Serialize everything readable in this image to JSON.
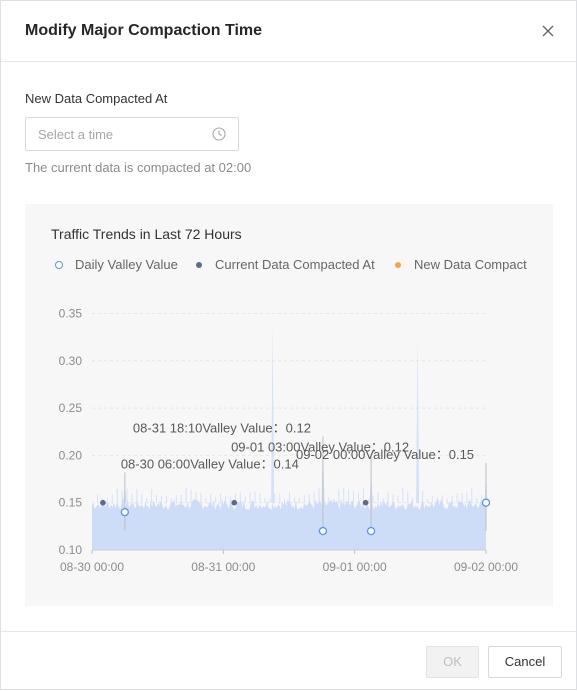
{
  "dialog": {
    "title": "Modify Major Compaction Time",
    "close_icon": "close-icon"
  },
  "form": {
    "label": "New Data Compacted At",
    "time_placeholder": "Select a time",
    "time_icon": "clock-icon",
    "hint": "The current data is compacted at 02:00"
  },
  "footer": {
    "ok_label": "OK",
    "ok_disabled": true,
    "cancel_label": "Cancel"
  },
  "chart_data": {
    "type": "area",
    "title": "Traffic Trends in Last 72 Hours",
    "xlabel": "",
    "ylabel": "",
    "ylim": [
      0.1,
      0.36
    ],
    "yticks": [
      "0.35",
      "0.30",
      "0.25",
      "0.20",
      "0.15",
      "0.10"
    ],
    "ytick_values": [
      0.35,
      0.3,
      0.25,
      0.2,
      0.15,
      0.1
    ],
    "xticks": [
      "08-30 00:00",
      "08-31 00:00",
      "09-01 00:00",
      "09-02 00:00"
    ],
    "xtick_hours": [
      0,
      24,
      48,
      72
    ],
    "x_range_hours": [
      0,
      72
    ],
    "grid": "horizontal",
    "legend_placement": "top-left",
    "colors": {
      "area": "#c5d7f7",
      "spike": "#d4e1fa",
      "valley": "#5b8ff9",
      "current": "#5d6b8a",
      "new": "#f7a14a"
    },
    "series": [
      {
        "name": "Daily Valley Value",
        "kind": "valley",
        "points": [
          {
            "x": 6,
            "y": 0.14
          },
          {
            "x": 42.2,
            "y": 0.12
          },
          {
            "x": 51,
            "y": 0.12
          },
          {
            "x": 72,
            "y": 0.15
          }
        ]
      },
      {
        "name": "Current Data Compacted At",
        "kind": "current",
        "points": [
          {
            "x": 2,
            "y": 0.15
          },
          {
            "x": 26,
            "y": 0.15
          },
          {
            "x": 50,
            "y": 0.15
          }
        ]
      },
      {
        "name": "New Data Compact",
        "kind": "new",
        "points": []
      }
    ],
    "traffic": {
      "baseline": 0.15,
      "spikes": [
        {
          "x": 33,
          "y": 0.34
        },
        {
          "x": 59.5,
          "y": 0.325
        },
        {
          "x": 42.2,
          "y": 0.215
        },
        {
          "x": 51,
          "y": 0.185
        },
        {
          "x": 72,
          "y": 0.185
        },
        {
          "x": 6,
          "y": 0.172
        }
      ]
    },
    "annotations": [
      {
        "text": "08-31 18:10Valley Value：0.12",
        "x": 42.2,
        "level": 0.22
      },
      {
        "text": "09-01 03:00Valley Value：0.12",
        "x": 51,
        "level": 0.2
      },
      {
        "text": "09-02 00:00Valley Value：0.15",
        "x": 72,
        "level": 0.192
      },
      {
        "text": "08-30 06:00Valley Value：0.14",
        "x": 6,
        "level": 0.182
      }
    ]
  }
}
